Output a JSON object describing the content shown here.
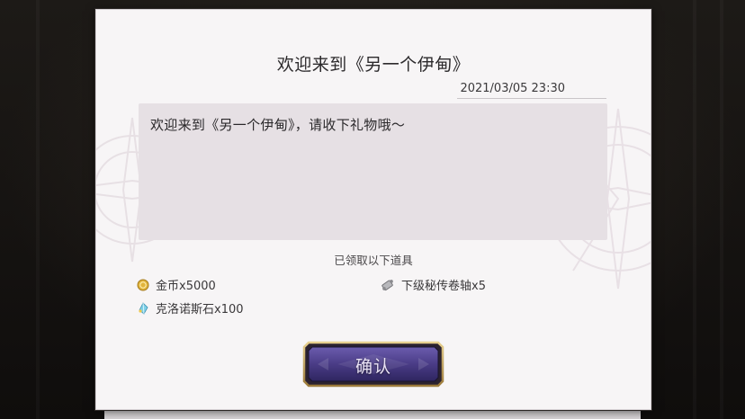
{
  "dialog": {
    "title": "欢迎来到《另一个伊甸》",
    "date": "2021/03/05 23:30",
    "message": "欢迎来到《另一个伊甸》，请收下礼物哦～",
    "received_label": "已领取以下道具",
    "confirm_label": "确认"
  },
  "items": [
    {
      "icon": "gold-coin-icon",
      "label": "金币x5000"
    },
    {
      "icon": "scroll-icon",
      "label": "下级秘传卷轴x5"
    },
    {
      "icon": "chronos-stone-icon",
      "label": "克洛诺斯石x100"
    }
  ],
  "colors": {
    "panel": "#f7f5f6",
    "message_box": "#e6e0e4",
    "button_purple": "#4d3f86",
    "button_gold": "#c9a962"
  }
}
